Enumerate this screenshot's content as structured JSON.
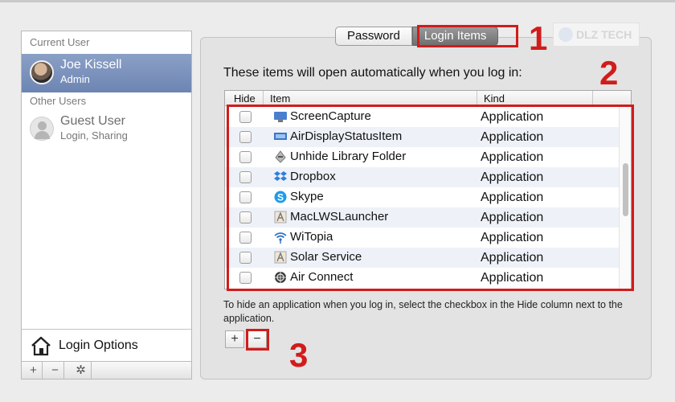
{
  "sidebar": {
    "current_user_label": "Current User",
    "current_user": {
      "name": "Joe Kissell",
      "role": "Admin"
    },
    "other_users_label": "Other Users",
    "other_user": {
      "name": "Guest User",
      "role": "Login, Sharing"
    },
    "login_options_label": "Login Options",
    "buttons": {
      "add": "+",
      "remove": "−",
      "action": "✲"
    }
  },
  "tabs": [
    {
      "label": "Password",
      "active": false
    },
    {
      "label": "Login Items",
      "active": true
    }
  ],
  "intro_text": "These items will open automatically when you log in:",
  "table": {
    "columns": [
      "Hide",
      "Item",
      "Kind"
    ],
    "rows": [
      {
        "name": "ScreenCapture",
        "kind": "Application",
        "icon": "screen-capture-icon"
      },
      {
        "name": "AirDisplayStatusItem",
        "kind": "Application",
        "icon": "air-display-icon"
      },
      {
        "name": "Unhide Library Folder",
        "kind": "Application",
        "icon": "script-icon"
      },
      {
        "name": "Dropbox",
        "kind": "Application",
        "icon": "dropbox-icon"
      },
      {
        "name": "Skype",
        "kind": "Application",
        "icon": "skype-icon"
      },
      {
        "name": "MacLWSLauncher",
        "kind": "Application",
        "icon": "generic-app-icon"
      },
      {
        "name": "WiTopia",
        "kind": "Application",
        "icon": "wifi-icon"
      },
      {
        "name": "Solar Service",
        "kind": "Application",
        "icon": "generic-app-icon"
      },
      {
        "name": "Air Connect",
        "kind": "Application",
        "icon": "air-connect-icon"
      }
    ]
  },
  "hint_text": "To hide an application when you log in, select the checkbox in the Hide column next to the application.",
  "list_buttons": {
    "add": "+",
    "remove": "−"
  },
  "annotations": [
    "1",
    "2",
    "3"
  ],
  "watermark": "DLZ TECH",
  "colors": {
    "highlight": "#d11c1c",
    "selection": "#7890bb"
  }
}
